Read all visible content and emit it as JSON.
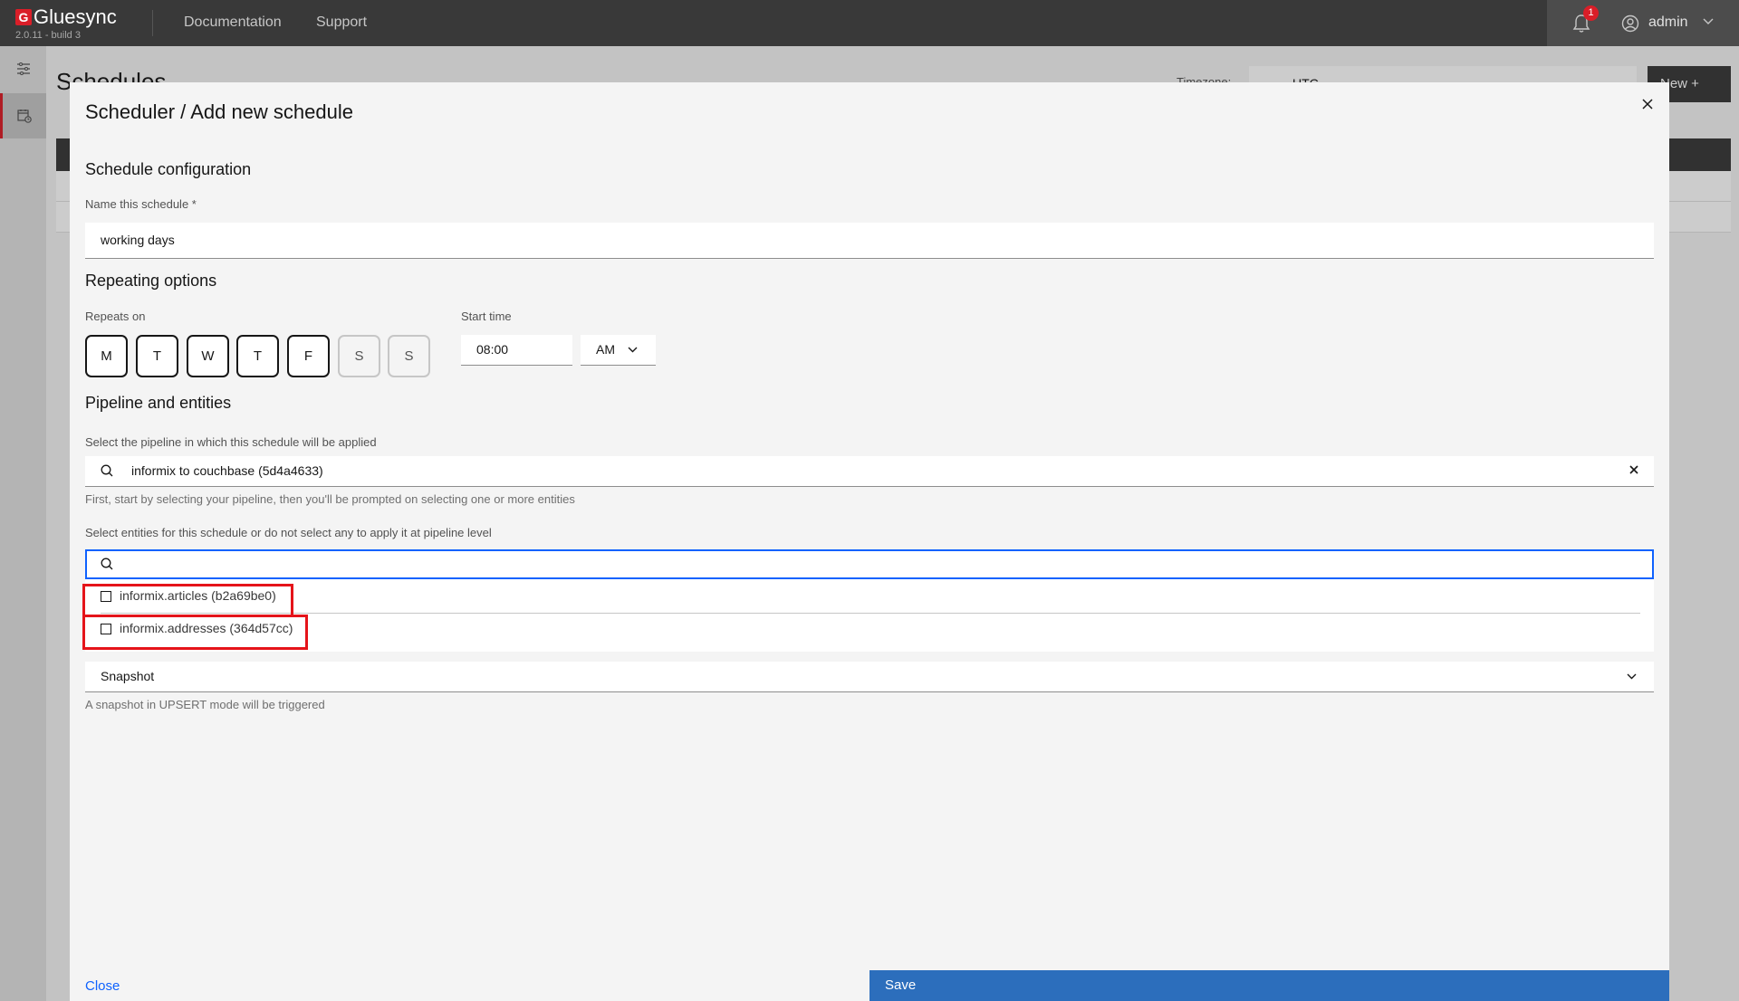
{
  "header": {
    "brand_name": "Gluesync",
    "version": "2.0.11 - build 3",
    "nav": [
      "Documentation",
      "Support"
    ],
    "notification_count": "1",
    "user_name": "admin"
  },
  "background": {
    "page_title": "Schedules",
    "timezone_label": "Timezone:",
    "timezone_value": "UTC",
    "new_button": "New +"
  },
  "modal": {
    "title": "Scheduler / Add new schedule",
    "schedule_config": {
      "heading": "Schedule configuration",
      "name_label": "Name this schedule *",
      "name_value": "working days"
    },
    "repeating": {
      "heading": "Repeating options",
      "repeats_label": "Repeats on",
      "days": [
        {
          "label": "M",
          "selected": true
        },
        {
          "label": "T",
          "selected": true
        },
        {
          "label": "W",
          "selected": true
        },
        {
          "label": "T",
          "selected": true
        },
        {
          "label": "F",
          "selected": true
        },
        {
          "label": "S",
          "selected": false
        },
        {
          "label": "S",
          "selected": false
        }
      ],
      "start_time_label": "Start time",
      "start_time_value": "08:00",
      "ampm_value": "AM"
    },
    "pipeline": {
      "heading": "Pipeline and entities",
      "pipeline_label": "Select the pipeline in which this schedule will be applied",
      "pipeline_value": "informix to couchbase (5d4a4633)",
      "pipeline_helper": "First, start by selecting your pipeline, then you'll be prompted on selecting one or more entities",
      "entities_label": "Select entities for this schedule or do not select any to apply it at pipeline level",
      "entity_search_value": "",
      "entities": [
        {
          "label": "informix.articles (b2a69be0)",
          "checked": false
        },
        {
          "label": "informix.addresses (364d57cc)",
          "checked": false
        }
      ],
      "mode_value": "Snapshot",
      "mode_helper": "A snapshot in UPSERT mode will be triggered"
    },
    "footer": {
      "close_label": "Close",
      "save_label": "Save"
    }
  },
  "colors": {
    "accent_red": "#da1e28",
    "primary_blue": "#2c6ebc",
    "focus_blue": "#0f62fe",
    "highlight_red": "#e5141a"
  }
}
